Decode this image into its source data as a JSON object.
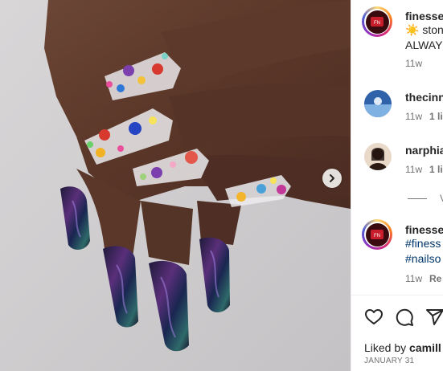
{
  "post_image": {
    "alt": "",
    "next_icon": "chevron-right-icon"
  },
  "comments": [
    {
      "username": "finesse",
      "lines": [
        "☀️ ston",
        "ALWAYS"
      ],
      "time": "11w",
      "likes": "",
      "reply": "",
      "avatar": "finesse-logo"
    },
    {
      "username": "thecinn",
      "lines": [],
      "time": "11w",
      "likes": "1 li",
      "reply": "",
      "avatar": "sky-photo"
    },
    {
      "username": "narphia",
      "lines": [],
      "time": "11w",
      "likes": "1 li",
      "reply": "",
      "avatar": "person-photo"
    },
    {
      "username": "finesse",
      "lines": [
        "#finess",
        "#nailso"
      ],
      "time": "11w",
      "likes": "",
      "reply": "Re",
      "avatar": "finesse-logo"
    }
  ],
  "view_replies": "V",
  "actions": [
    "heart-icon",
    "comment-icon",
    "share-icon"
  ],
  "liked_by": {
    "prefix": "Liked by ",
    "user": "camill"
  },
  "date": "JANUARY 31"
}
